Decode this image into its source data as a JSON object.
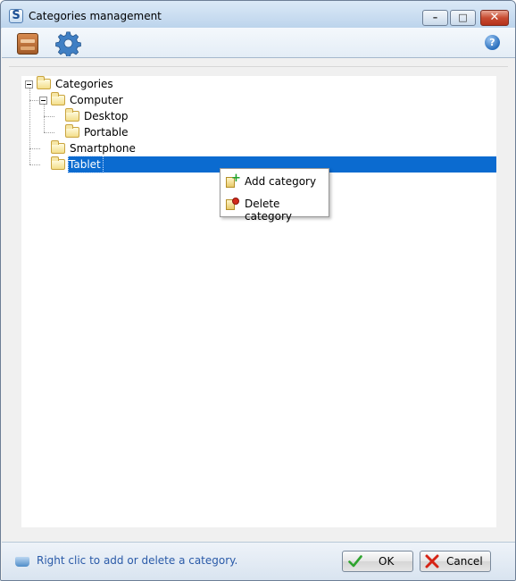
{
  "window": {
    "title": "Categories management",
    "app_icon_letter": "S"
  },
  "title_controls": {
    "minimize": "–",
    "maximize": "□",
    "close": "✕"
  },
  "toolbar": {
    "help_glyph": "?"
  },
  "tree": {
    "root": "Categories",
    "items": [
      {
        "label": "Computer",
        "children": [
          "Desktop",
          "Portable"
        ]
      },
      {
        "label": "Smartphone"
      },
      {
        "label": "Tablet",
        "selected": true
      }
    ]
  },
  "context_menu": {
    "add_label": "Add category",
    "delete_label": "Delete category"
  },
  "status": {
    "hint": "Right clic to add or delete a category."
  },
  "buttons": {
    "ok": "OK",
    "cancel": "Cancel"
  },
  "colors": {
    "selection": "#0b6bd0",
    "hint_text": "#2a5aa8"
  }
}
